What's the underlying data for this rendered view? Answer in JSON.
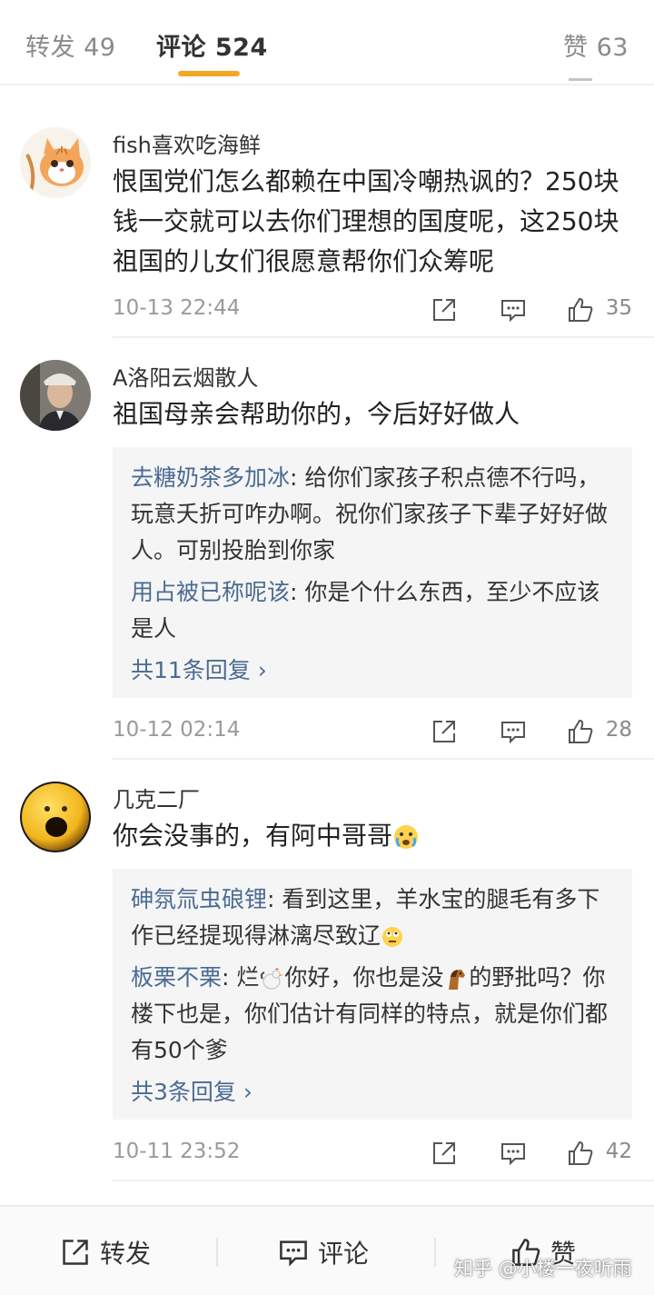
{
  "tabs": {
    "repost": "转发 49",
    "comment": "评论 524",
    "like": "赞 63"
  },
  "comments": [
    {
      "username": "fish喜欢吃海鲜",
      "text": "恨国党们怎么都赖在中国冷嘲热讽的？250块钱一交就可以去你们理想的国度呢，这250块祖国的儿女们很愿意帮你们众筹呢",
      "time": "10-13 22:44",
      "likes": "35",
      "avatar_icon": "cat-avatar-icon"
    },
    {
      "username": "A洛阳云烟散人",
      "text": "祖国母亲会帮助你的，今后好好做人",
      "replies": [
        {
          "name": "去糖奶茶多加冰",
          "text": ": 给你们家孩子积点德不行吗，玩意夭折可咋办啊。祝你们家孩子下辈子好好做人。可别投胎到你家"
        },
        {
          "name": "用占被已称呢该",
          "text": ": 你是个什么东西，至少不应该是人"
        }
      ],
      "more": "共11条回复 ›",
      "time": "10-12 02:14",
      "likes": "28",
      "avatar_icon": "man-photo-avatar-icon"
    },
    {
      "username": "几克二厂",
      "text": "你会没事的，有阿中哥哥",
      "text_emoji": "crying-face-emoji",
      "replies": [
        {
          "name": "砷氛氚虫硠锂",
          "text": ": 看到这里，羊水宝的腿毛有多下作已经提现得淋漓尽致辽",
          "emoji_after": "rolling-eyes-emoji"
        },
        {
          "name": "板栗不栗",
          "text_parts": [
            ": 烂",
            "你好，你也是没",
            "的野批吗？你楼下也是，你们估计有同样的特点，就是你们都有50个爹"
          ],
          "emojis": [
            "rooster-emoji",
            "horse-emoji"
          ]
        }
      ],
      "more": "共3条回复 ›",
      "time": "10-11 23:52",
      "likes": "42",
      "avatar_icon": "yellow-face-avatar-icon"
    }
  ],
  "bottom_bar": {
    "repost": "转发",
    "comment": "评论",
    "like": "赞"
  },
  "watermark": "知乎 @小楼一夜听雨",
  "colors": {
    "accent_underline": "#f5a623",
    "reply_name": "#4a6b93",
    "timestamp": "#9a9a9a"
  }
}
